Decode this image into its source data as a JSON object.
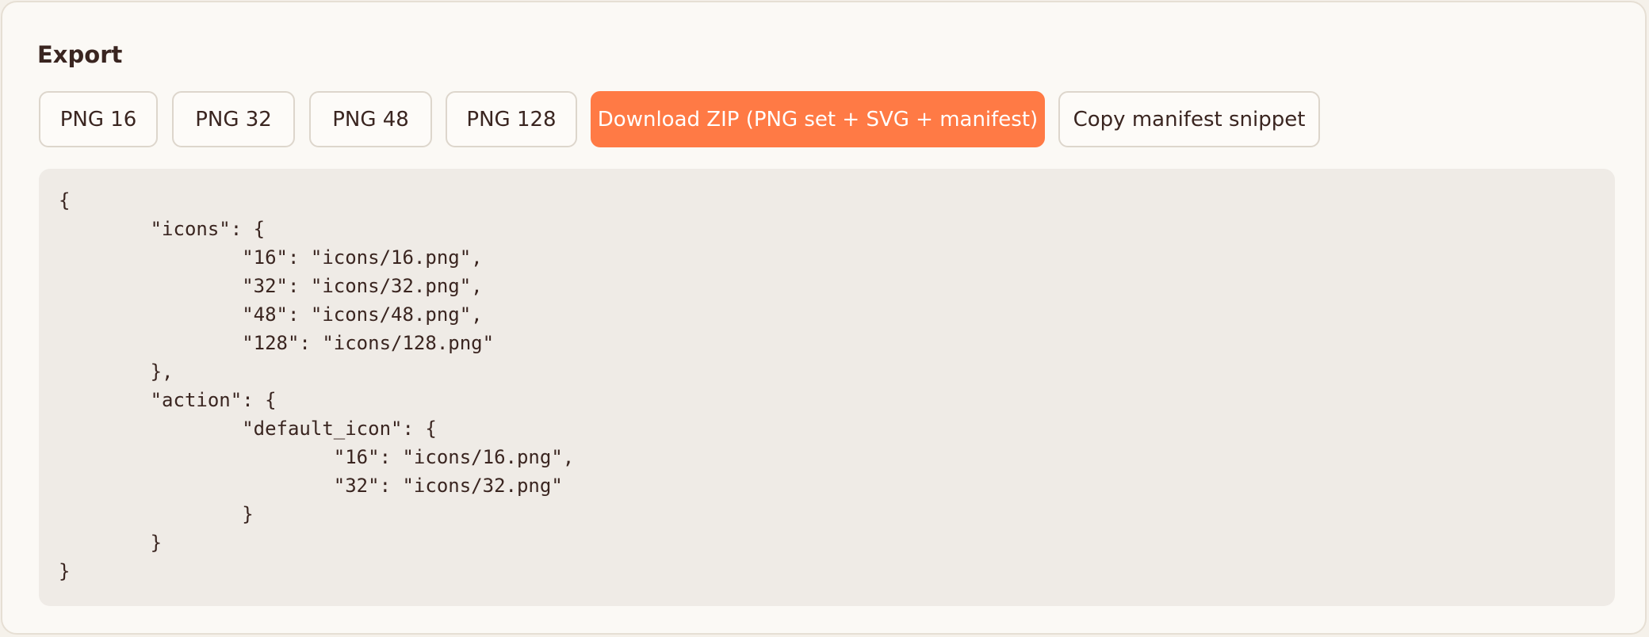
{
  "export": {
    "title": "Export",
    "buttons": [
      {
        "label": "PNG 16"
      },
      {
        "label": "PNG 32"
      },
      {
        "label": "PNG 48"
      },
      {
        "label": "PNG 128"
      },
      {
        "label": "Download ZIP (PNG set + SVG + manifest)"
      },
      {
        "label": "Copy manifest snippet"
      }
    ],
    "manifest_snippet": "{\n\t\"icons\": {\n\t\t\"16\": \"icons/16.png\",\n\t\t\"32\": \"icons/32.png\",\n\t\t\"48\": \"icons/48.png\",\n\t\t\"128\": \"icons/128.png\"\n\t},\n\t\"action\": {\n\t\t\"default_icon\": {\n\t\t\t\"16\": \"icons/16.png\",\n\t\t\t\"32\": \"icons/32.png\"\n\t\t}\n\t}\n}"
  },
  "colors": {
    "accent": "#ff7a45",
    "text": "#3a2520",
    "code_background": "#efebe6",
    "panel_background": "#fbf9f5"
  }
}
